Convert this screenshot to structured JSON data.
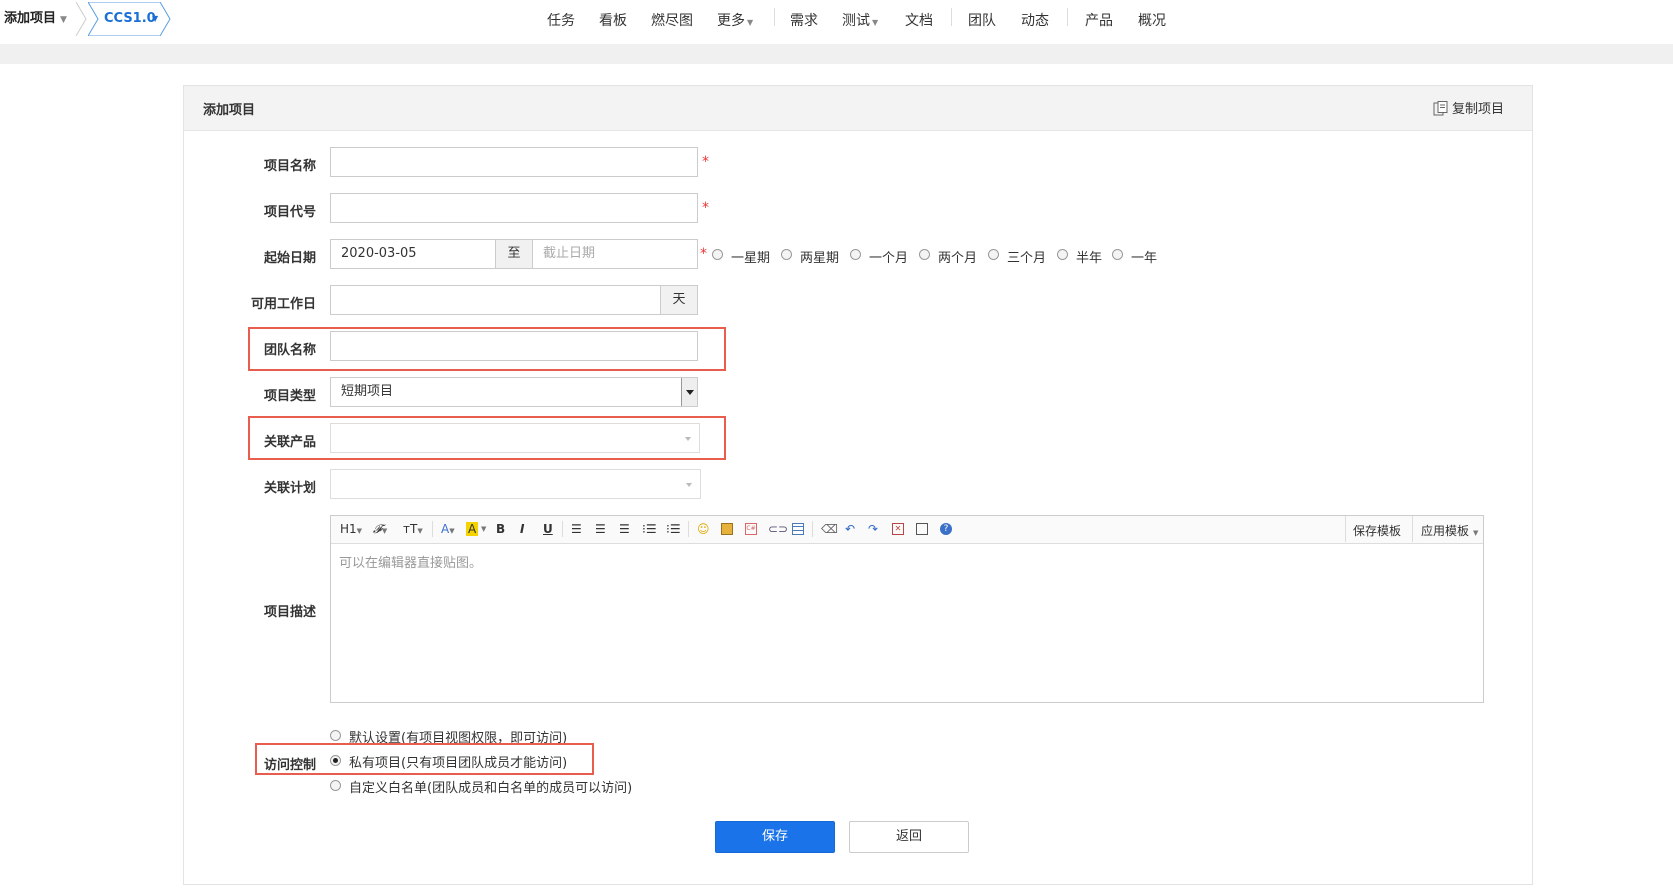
{
  "breadcrumb": {
    "root": "添加项目",
    "project": "CCS1.0"
  },
  "nav": {
    "items": [
      "任务",
      "看板",
      "燃尽图",
      "更多",
      "需求",
      "测试",
      "文档",
      "团队",
      "动态",
      "产品",
      "概况"
    ]
  },
  "panel": {
    "title": "添加项目",
    "copy_label": "复制项目"
  },
  "form": {
    "name_label": "项目名称",
    "code_label": "项目代号",
    "date_label": "起始日期",
    "start_date": "2020-03-05",
    "to_label": "至",
    "end_placeholder": "截止日期",
    "durations": [
      "一星期",
      "两星期",
      "一个月",
      "两个月",
      "三个月",
      "半年",
      "一年"
    ],
    "workdays_label": "可用工作日",
    "workdays_unit": "天",
    "team_label": "团队名称",
    "type_label": "项目类型",
    "type_value": "短期项目",
    "product_label": "关联产品",
    "plan_label": "关联计划",
    "desc_label": "项目描述",
    "desc_placeholder": "可以在编辑器直接贴图。",
    "acl_label": "访问控制",
    "acl_options": [
      "默认设置(有项目视图权限，即可访问)",
      "私有项目(只有项目团队成员才能访问)",
      "自定义白名单(团队成员和白名单的成员可以访问)"
    ],
    "acl_selected": 1,
    "required_mark": "*"
  },
  "editor": {
    "h1": "H1",
    "save_template": "保存模板",
    "apply_template": "应用模板"
  },
  "buttons": {
    "save": "保存",
    "back": "返回"
  },
  "colors": {
    "primary": "#1a73e8",
    "highlight_box": "#e95d4f",
    "link": "#1a6fd6"
  }
}
